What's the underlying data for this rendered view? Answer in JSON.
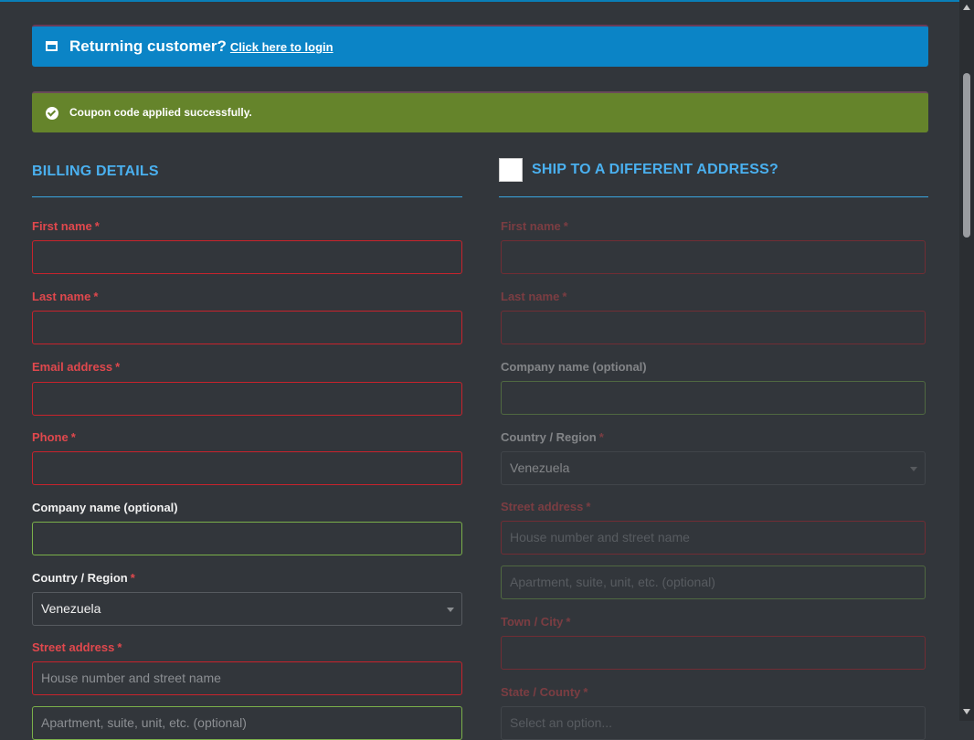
{
  "notices": {
    "returning_title": "Returning customer?",
    "returning_link": "Click here to login",
    "coupon_msg": "Coupon code applied successfully."
  },
  "billing": {
    "title": "BILLING DETAILS",
    "first_name": "First name",
    "last_name": "Last name",
    "email": "Email address",
    "phone": "Phone",
    "company": "Company name (optional)",
    "country": "Country / Region",
    "country_value": "Venezuela",
    "street": "Street address",
    "street_placeholder": "House number and street name",
    "street2_placeholder": "Apartment, suite, unit, etc. (optional)",
    "required_mark": "*"
  },
  "shipping": {
    "title": "SHIP TO A DIFFERENT ADDRESS?",
    "first_name": "First name",
    "last_name": "Last name",
    "company": "Company name (optional)",
    "country": "Country / Region",
    "country_value": "Venezuela",
    "street": "Street address",
    "street_placeholder": "House number and street name",
    "street2_placeholder": "Apartment, suite, unit, etc. (optional)",
    "town": "Town / City",
    "state": "State / County",
    "state_placeholder": "Select an option...",
    "required_mark": "*"
  },
  "colors": {
    "info": "#0b84c6",
    "success": "#65842b",
    "heading": "#4ab0ef",
    "required": "#e0484d"
  }
}
